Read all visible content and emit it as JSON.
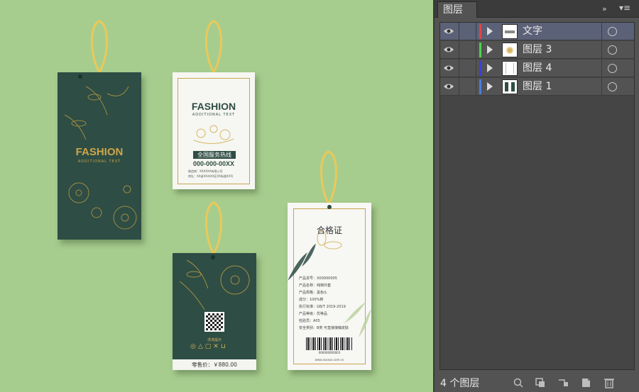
{
  "canvas": {
    "tag1": {
      "title": "FASHION",
      "subtitle": "ADDITIONAL TEXT"
    },
    "tag2": {
      "title": "FASHION",
      "subtitle": "ADDITIONAL TEXT",
      "hotline_label": "全国服务热线",
      "hotline_number": "000-000-00XX",
      "maker_line": "制造商：XXXXXX有限公司",
      "address_line": "地址：XX省XX市XX区XX街道XX号"
    },
    "tag3": {
      "care_label": "洗涤提示",
      "price": "零售价：￥880.00"
    },
    "tag4": {
      "title": "合格证",
      "lines": [
        "产品货号：X00000005",
        "产品名称：纯棉外套",
        "产品规格：黑色/L",
        "成分：100%棉",
        "执行标准：GB/T 2019-2019",
        "产品等级：优等品",
        "检验员：A05",
        "安全类别：B类 可直接接触皮肤"
      ],
      "barcode_number": "000000000003",
      "website": "www.xxxxxx.com.cn"
    }
  },
  "panel": {
    "tab_title": "图层",
    "collapse_icon": "»",
    "menu_icon": "▾≡",
    "layers": [
      {
        "name": "文字",
        "color": "#e04646",
        "selected": true
      },
      {
        "name": "图层 3",
        "color": "#4fd14f",
        "selected": false
      },
      {
        "name": "图层 4",
        "color": "#3f3fd9",
        "selected": false
      },
      {
        "name": "图层 1",
        "color": "#4a7de0",
        "selected": false
      }
    ],
    "layer_count": "4 个图层",
    "footer_icons": [
      "locate-object-icon",
      "clipping-mask-icon",
      "new-sublayer-icon",
      "new-layer-icon",
      "trash-icon"
    ]
  }
}
